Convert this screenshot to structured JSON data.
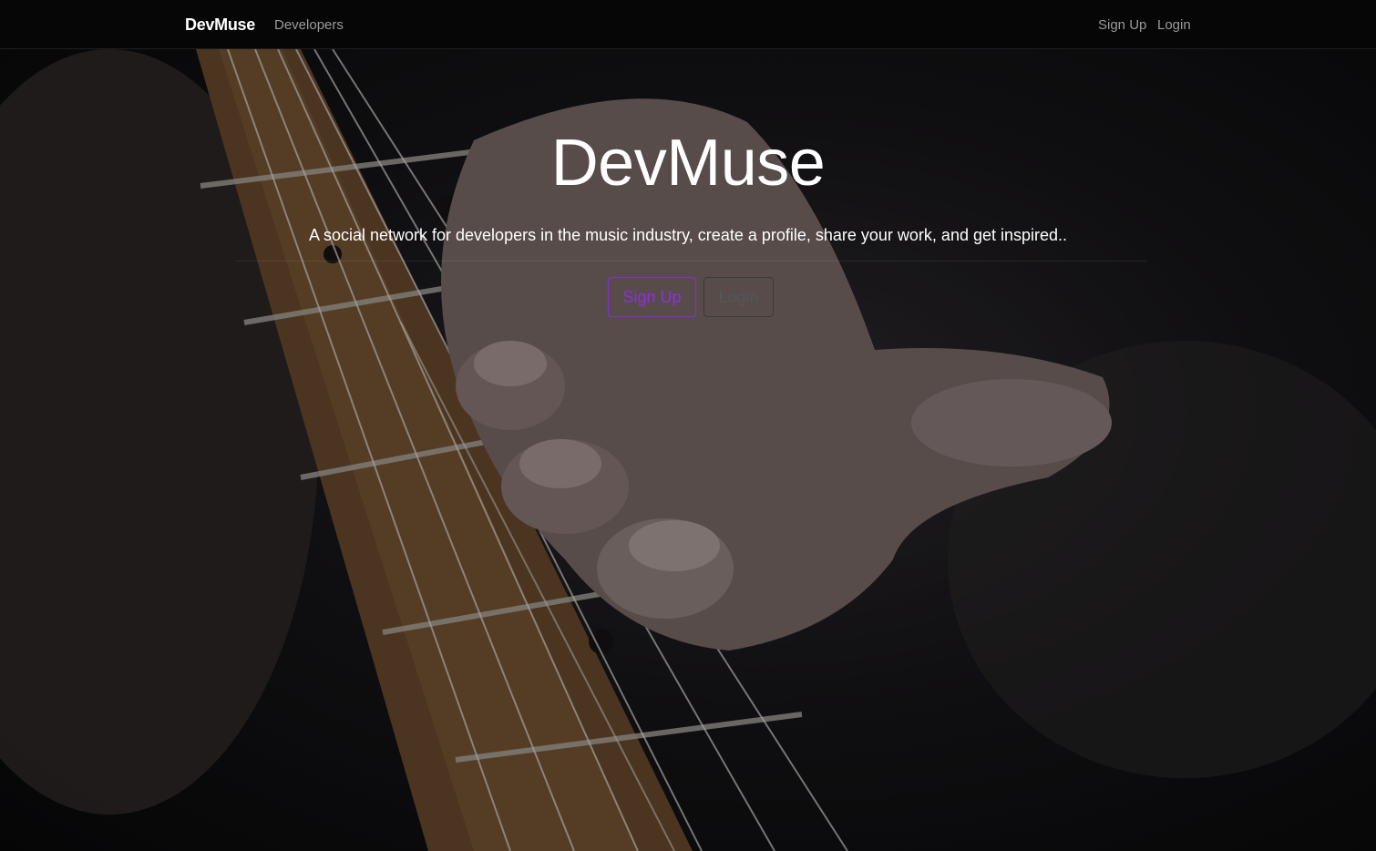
{
  "navbar": {
    "brand": "DevMuse",
    "links": [
      {
        "label": "Developers"
      },
      {
        "label": "Sign Up"
      },
      {
        "label": "Login"
      }
    ]
  },
  "hero": {
    "title": "DevMuse",
    "lead": "A social network for developers in the music industry, create a profile, share your work, and get inspired..",
    "buttons": {
      "signup_label": "Sign Up",
      "login_label": "Login"
    }
  },
  "colors": {
    "accent": "#8e2de2",
    "navbar_bg": "#060607",
    "hero_text": "#ffffff"
  }
}
